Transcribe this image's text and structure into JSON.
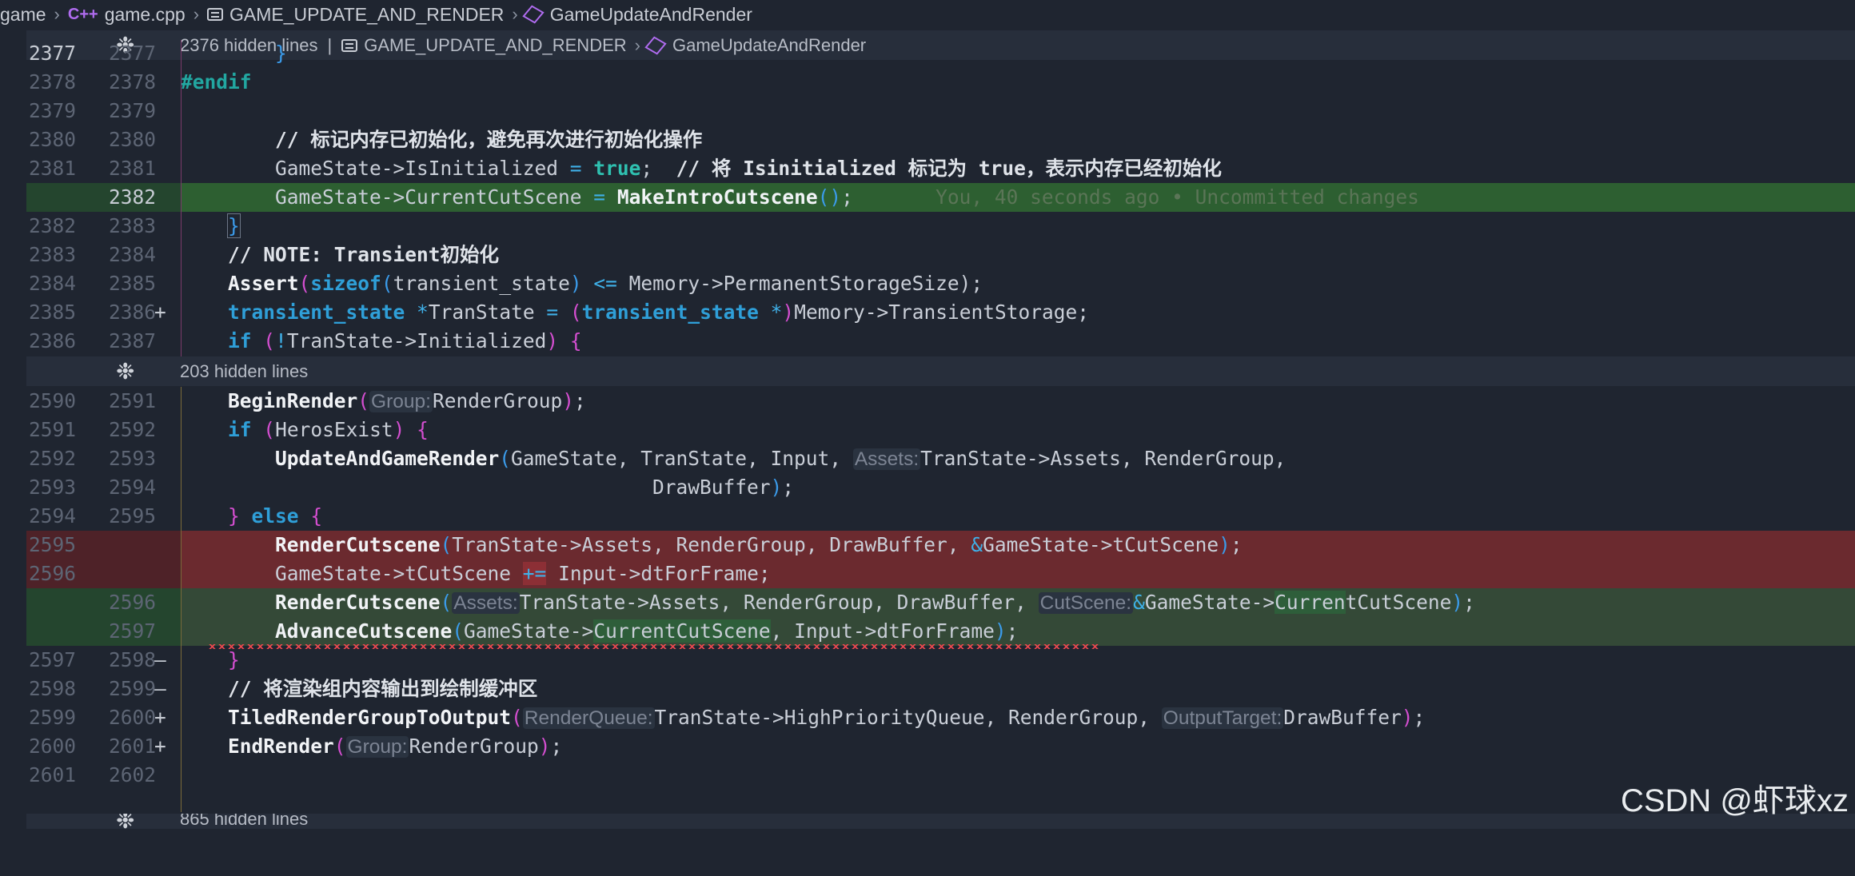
{
  "breadcrumb": {
    "root": "game",
    "file": "game.cpp",
    "file_icon": "C++",
    "namespace": "GAME_UPDATE_AND_RENDER",
    "symbol": "GameUpdateAndRender"
  },
  "folds": [
    {
      "text": "2376 hidden lines",
      "sep": "|",
      "ns": "GAME_UPDATE_AND_RENDER",
      "symbol": "GameUpdateAndRender"
    },
    {
      "text": "203 hidden lines"
    },
    {
      "text": "865 hidden lines"
    }
  ],
  "lines": [
    {
      "old": "2377",
      "new": "2377"
    },
    {
      "old": "2378",
      "new": "2378"
    },
    {
      "old": "2379",
      "new": "2379"
    },
    {
      "old": "2380",
      "new": "2380"
    },
    {
      "old": "2381",
      "new": "2381"
    },
    {
      "old": "",
      "new": "2382",
      "mark": "+"
    },
    {
      "old": "2382",
      "new": "2383"
    },
    {
      "old": "2383",
      "new": "2384"
    },
    {
      "old": "2384",
      "new": "2385"
    },
    {
      "old": "2385",
      "new": "2386"
    },
    {
      "old": "2386",
      "new": "2387"
    },
    {
      "old": "2590",
      "new": "2591"
    },
    {
      "old": "2591",
      "new": "2592"
    },
    {
      "old": "2592",
      "new": "2593"
    },
    {
      "old": "2593",
      "new": "2594"
    },
    {
      "old": "2594",
      "new": "2595"
    },
    {
      "old": "2595",
      "new": "",
      "mark": "—"
    },
    {
      "old": "2596",
      "new": "",
      "mark": "—"
    },
    {
      "old": "",
      "new": "2596",
      "mark": "+"
    },
    {
      "old": "",
      "new": "2597",
      "mark": "+"
    },
    {
      "old": "2597",
      "new": "2598"
    },
    {
      "old": "2598",
      "new": "2599"
    },
    {
      "old": "2599",
      "new": "2600"
    },
    {
      "old": "2600",
      "new": "2601"
    },
    {
      "old": "2601",
      "new": "2602"
    }
  ],
  "code": {
    "l2377": "}",
    "l2378": "#endif",
    "l2380": "// 标记内存已初始化，避免再次进行初始化操作",
    "l2381_a": "GameState->IsInitialized ",
    "l2381_eq": "=",
    "l2381_true": "true",
    "l2381_semi": ";  ",
    "l2381_cmt": "// 将 Isinitialized 标记为 true，表示内存已经初始化",
    "l2382_a": "GameState->CurrentCutScene ",
    "l2382_eq": "=",
    "l2382_fn": "MakeIntroCutscene",
    "l2382_paren": "()",
    "l2382_semi": ";",
    "blame": "You, 40 seconds ago • Uncommitted changes",
    "l2383": "}",
    "l2384": "// NOTE: Transient初始化",
    "l2385_fn": "Assert",
    "l2385_kw": "sizeof",
    "l2385_arg": "transient_state",
    "l2385_op": "<=",
    "l2385_rest": " Memory->PermanentStorageSize",
    "l2385_end": ");",
    "l2386_type": "transient_state",
    "l2386_star": "*",
    "l2386_var": "TranState ",
    "l2386_eq": "=",
    "l2386_type2": "transient_state",
    "l2386_star2": "*",
    "l2386_rest": "Memory->TransientStorage;",
    "l2387_kw": "if",
    "l2387_not": "!",
    "l2387_rest": "TranState->Initialized",
    "l2591_fn": "BeginRender",
    "l2591_hint": "Group:",
    "l2591_arg": "RenderGroup",
    "l2591_end": ";",
    "l2592_kw": "if",
    "l2592_arg": "HerosExist",
    "l2593_fn": "UpdateAndGameRender",
    "l2593_args": "GameState, TranState, Input, ",
    "l2593_hint": "Assets:",
    "l2593_rest": "TranState->Assets, RenderGroup,",
    "l2594_arg": "DrawBuffer",
    "l2594_end": ";",
    "l2595_kw": "else",
    "d2595_fn": "RenderCutscene",
    "d2595_args": "TranState->Assets, RenderGroup, DrawBuffer, ",
    "d2595_amp": "&",
    "d2595_rest": "GameState->tCutScene",
    "d2595_end": ";",
    "d2596_a": "GameState->tCutScene",
    "d2596_op": "+=",
    "d2596_rest": " Input->dtForFrame;",
    "a2596_fn": "RenderCutscene",
    "a2596_hint1": "Assets:",
    "a2596_args": "TranState->Assets, RenderGroup, DrawBuffer, ",
    "a2596_hint2": "CutScene:",
    "a2596_amp": "&",
    "a2596_rest_a": "GameState->",
    "a2596_rest_b": "Curren",
    "a2596_rest_c": "tCutScene",
    "a2596_end": ";",
    "a2597_fn": "AdvanceCutscene",
    "a2597_a": "GameState->",
    "a2597_b": "CurrentCutScene",
    "a2597_c": ", Input->dtForFrame",
    "a2597_end": ";",
    "l2598": "}",
    "l2599": "// 将渲染组内容输出到绘制缓冲区",
    "l2600_fn": "TiledRenderGroupToOutput",
    "l2600_hint1": "RenderQueue:",
    "l2600_a": "TranState->HighPriorityQueue, RenderGroup, ",
    "l2600_hint2": "OutputTarget:",
    "l2600_b": "DrawBuffer",
    "l2600_end": ";",
    "l2601_fn": "EndRender",
    "l2601_hint": "Group:",
    "l2601_arg": "RenderGroup",
    "l2601_end": ";"
  },
  "watermark": "CSDN @虾球xz",
  "colors": {
    "added_line": "#2d5f31",
    "deleted_line": "#6b2a2f",
    "keyword": "#2f9fd8",
    "bracket": "#d44ed0"
  }
}
